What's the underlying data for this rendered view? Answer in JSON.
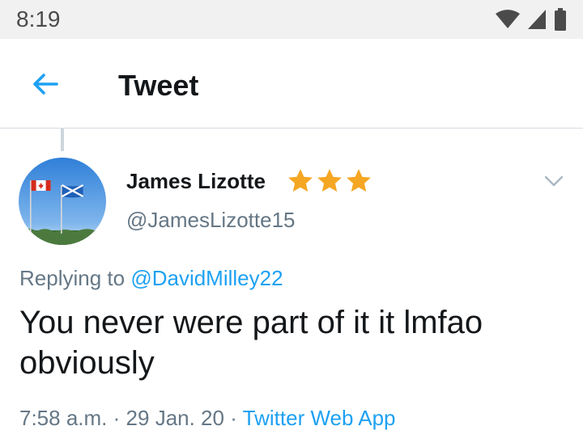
{
  "status_bar": {
    "time": "8:19",
    "icons": [
      "wifi-icon",
      "cellular-signal-icon",
      "battery-icon"
    ]
  },
  "app_bar": {
    "back_icon": "arrow-left-icon",
    "title": "Tweet"
  },
  "tweet": {
    "author": {
      "display_name": "James Lizotte",
      "badge_stars": 3,
      "handle": "@JamesLizotte15",
      "avatar_description": "flags"
    },
    "replying_prefix": "Replying to",
    "replying_to": "@DavidMilley22",
    "text": "You never were part of it it lmfao obviously",
    "time": "7:58 a.m.",
    "separator": "·",
    "date": "29 Jan. 20",
    "source": "Twitter Web App"
  },
  "colors": {
    "accent": "#1da1f2",
    "secondary_text": "#657786",
    "primary_text": "#14171a",
    "star": "#f5a623",
    "status_bar_bg": "#f1f1f1"
  }
}
